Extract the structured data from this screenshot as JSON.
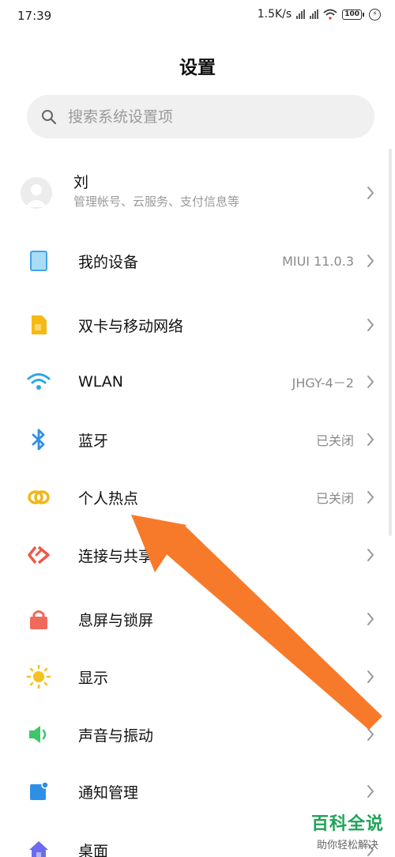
{
  "status_bar": {
    "time": "17:39",
    "network_speed": "1.5K/s",
    "battery": "100"
  },
  "title": "设置",
  "search": {
    "placeholder": "搜索系统设置项"
  },
  "account": {
    "name": "刘",
    "subtitle": "管理帐号、云服务、支付信息等"
  },
  "items": [
    {
      "label": "我的设备",
      "value": "MIUI 11.0.3",
      "icon": "device-icon",
      "color": "#43a4e8"
    },
    {
      "label": "双卡与移动网络",
      "value": "",
      "icon": "sim-card-icon",
      "color": "#f5b914"
    },
    {
      "label": "WLAN",
      "value": "JHGY-4－2",
      "icon": "wifi-icon",
      "color": "#2aa7e8"
    },
    {
      "label": "蓝牙",
      "value": "已关闭",
      "icon": "bluetooth-icon",
      "color": "#2f8fe8"
    },
    {
      "label": "个人热点",
      "value": "已关闭",
      "icon": "hotspot-icon",
      "color": "#f0b818"
    },
    {
      "label": "连接与共享",
      "value": "",
      "icon": "connection-share-icon",
      "color": "#ef5a47"
    },
    {
      "label": "息屏与锁屏",
      "value": "",
      "icon": "lock-icon",
      "color": "#f06a5a"
    },
    {
      "label": "显示",
      "value": "",
      "icon": "brightness-icon",
      "color": "#f5c21b"
    },
    {
      "label": "声音与振动",
      "value": "",
      "icon": "sound-icon",
      "color": "#3cc76a"
    },
    {
      "label": "通知管理",
      "value": "",
      "icon": "notification-icon",
      "color": "#2e8fe6"
    },
    {
      "label": "桌面",
      "value": "",
      "icon": "home-icon",
      "color": "#6b6cf0"
    }
  ],
  "annotation": {
    "color": "#f77a2a"
  },
  "watermark": {
    "title": "百科全说",
    "subtitle": "助你轻松解决"
  }
}
